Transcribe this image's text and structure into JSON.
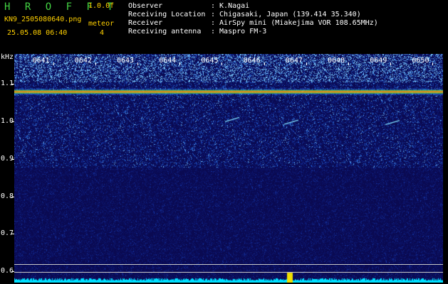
{
  "header": {
    "app_title": "H R O F F T",
    "version": "1.0.0f",
    "file_name": "KN9_2505080640.png",
    "mode_label": "meteor",
    "timestamp": "25.05.08 06:40",
    "mode_value": "4",
    "info": [
      {
        "key": "Observer",
        "value": ": K.Nagai"
      },
      {
        "key": "Receiving Location",
        "value": ": Chigasaki, Japan (139.414 35.340)"
      },
      {
        "key": "Receiver",
        "value": ": AirSpy mini (Miakejima VOR 108.65MHz)"
      },
      {
        "key": "Receiving antenna",
        "value": ": Maspro FM-3"
      }
    ]
  },
  "colors": {
    "background": "#000000",
    "header_green": "#43d343",
    "header_yellow": "#ffd000",
    "plot_background": "#0a0a52",
    "carrier": "#ff6a00",
    "spectrum": "#00e0ff"
  },
  "chart_data": {
    "type": "heatmap",
    "ylabel": "kHz",
    "y_ticks": [
      "1.1",
      "1.0",
      "0.9",
      "0.8",
      "0.7",
      "0.6"
    ],
    "x_ticks": [
      "0641",
      "0642",
      "0643",
      "0644",
      "0645",
      "0646",
      "0647",
      "0648",
      "0649",
      "0650"
    ],
    "ylim": [
      0.57,
      1.18
    ],
    "carrier_khz": 1.08,
    "reference_lines_khz": [
      0.62,
      0.598
    ],
    "meteor_echoes": [
      {
        "time": "0645.5",
        "khz": 1.005
      },
      {
        "time": "0646.9",
        "khz": 0.998
      },
      {
        "time": "0649.3",
        "khz": 0.997
      }
    ]
  }
}
